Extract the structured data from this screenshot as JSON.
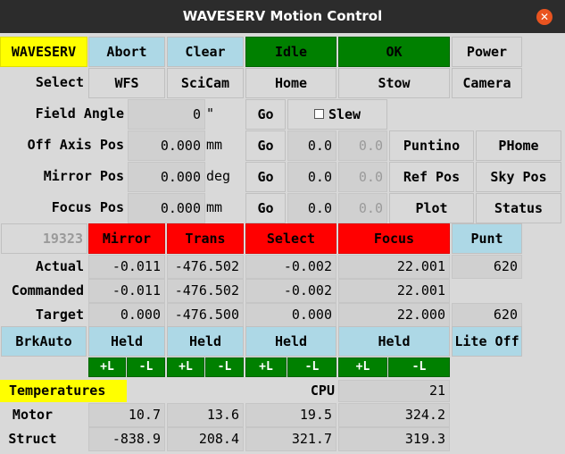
{
  "window": {
    "title": "WAVESERV Motion Control",
    "close_icon": "close-icon"
  },
  "colors": {
    "blue": "#add8e6",
    "green": "#008000",
    "red": "#ff0000",
    "yellow": "#ffff00",
    "bg": "#d9d9d9",
    "titlebar": "#2c2c2c",
    "close": "#e95420"
  },
  "status_row": {
    "name": "WAVESERV",
    "abort": "Abort",
    "clear": "Clear",
    "state": "Idle",
    "health": "OK",
    "power": "Power"
  },
  "select_row": {
    "label": "Select",
    "wfs": "WFS",
    "scicam": "SciCam",
    "home": "Home",
    "stow": "Stow",
    "camera": "Camera"
  },
  "field_angle": {
    "label": "Field Angle",
    "value": "0",
    "unit": "\"",
    "go": "Go",
    "slew": "Slew"
  },
  "off_axis": {
    "label": "Off Axis Pos",
    "value": "0.000",
    "unit": "mm",
    "go": "Go",
    "step": "0.0",
    "step2": "0.0",
    "btn1": "Puntino",
    "btn2": "PHome"
  },
  "mirror_pos": {
    "label": "Mirror Pos",
    "value": "0.000",
    "unit": "deg",
    "go": "Go",
    "step": "0.0",
    "step2": "0.0",
    "btn1": "Ref Pos",
    "btn2": "Sky Pos"
  },
  "focus_pos": {
    "label": "Focus Pos",
    "value": "0.000",
    "unit": "mm",
    "go": "Go",
    "step": "0.0",
    "step2": "0.0",
    "btn1": "Plot",
    "btn2": "Status"
  },
  "axes_header": {
    "id": "19323",
    "mirror": "Mirror",
    "trans": "Trans",
    "select": "Select",
    "focus": "Focus",
    "punt": "Punt"
  },
  "axis_table": [
    {
      "label": "Actual",
      "mirror": "-0.011",
      "trans": "-476.502",
      "select": "-0.002",
      "focus": "22.001",
      "punt": "620"
    },
    {
      "label": "Commanded",
      "mirror": "-0.011",
      "trans": "-476.502",
      "select": "-0.002",
      "focus": "22.001",
      "punt": ""
    },
    {
      "label": "Target",
      "mirror": "0.000",
      "trans": "-476.500",
      "select": "0.000",
      "focus": "22.000",
      "punt": "620"
    }
  ],
  "brake_row": {
    "brkauto": "BrkAuto",
    "mirror": "Held",
    "trans": "Held",
    "select": "Held",
    "focus": "Held",
    "lite": "Lite Off"
  },
  "limits": [
    "+L",
    "-L",
    "+L",
    "-L",
    "+L",
    "-L",
    "+L",
    "-L"
  ],
  "temps": {
    "header": "Temperatures",
    "cpu_label": "CPU",
    "cpu_value": "21",
    "rows": [
      {
        "label": "Motor",
        "values": [
          "10.7",
          "13.6",
          "19.5",
          "324.2"
        ]
      },
      {
        "label": "Struct",
        "values": [
          "-838.9",
          "208.4",
          "321.7",
          "319.3"
        ]
      }
    ]
  }
}
